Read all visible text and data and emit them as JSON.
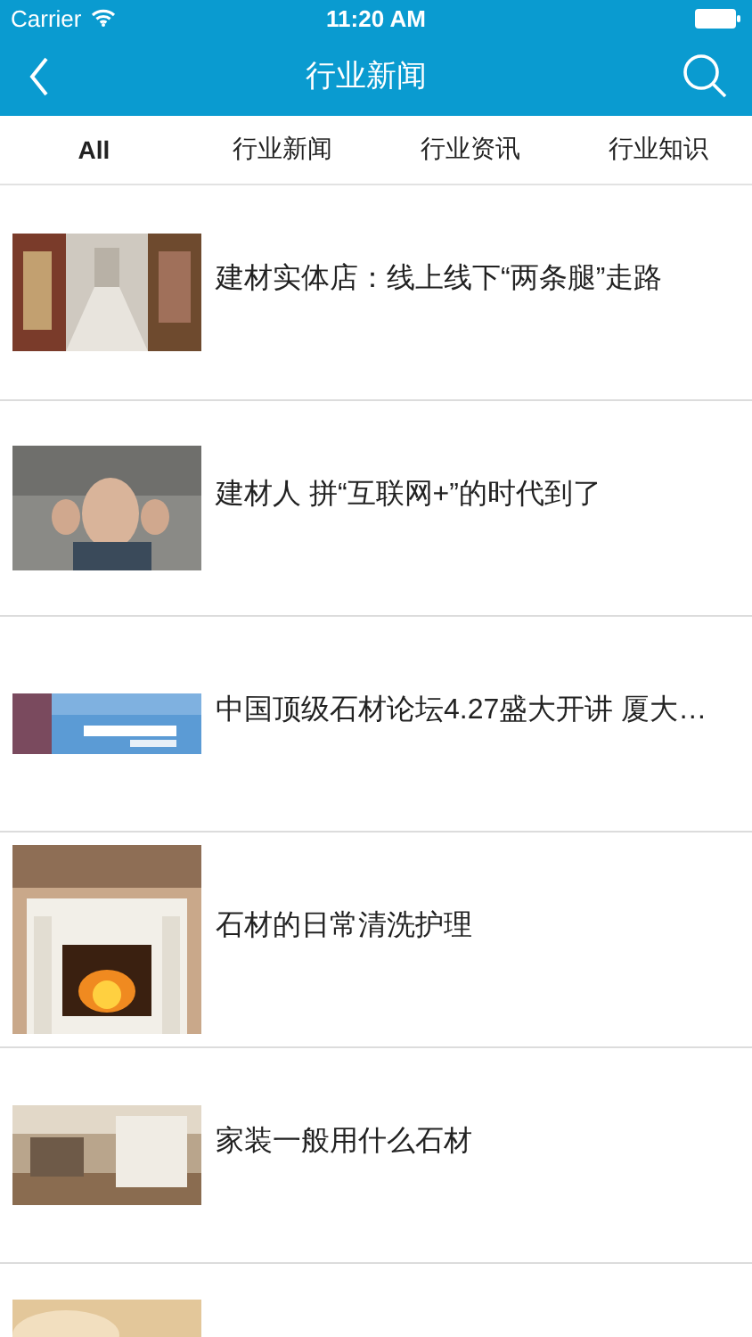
{
  "status_bar": {
    "carrier": "Carrier",
    "time": "11:20 AM"
  },
  "nav_bar": {
    "title": "行业新闻"
  },
  "tabs": [
    {
      "label": "All",
      "selected": true
    },
    {
      "label": "行业新闻",
      "selected": false
    },
    {
      "label": "行业资讯",
      "selected": false
    },
    {
      "label": "行业知识",
      "selected": false
    }
  ],
  "articles": [
    {
      "title": "建材实体店：线上线下“两条腿”走路",
      "thumbnail": {
        "kind": "picture"
      }
    },
    {
      "title": "建材人 拼“互联网+”的时代到了",
      "thumbnail": {
        "kind": "picture"
      }
    },
    {
      "title": "中国顶级石材论坛4.27盛大开讲 厦大…",
      "thumbnail": {
        "kind": "picture"
      }
    },
    {
      "title": "石材的日常清洗护理",
      "thumbnail": {
        "kind": "picture"
      }
    },
    {
      "title": "家装一般用什么石材",
      "thumbnail": {
        "kind": "picture"
      }
    },
    {
      "thumbnail": {
        "kind": "picture"
      }
    }
  ]
}
